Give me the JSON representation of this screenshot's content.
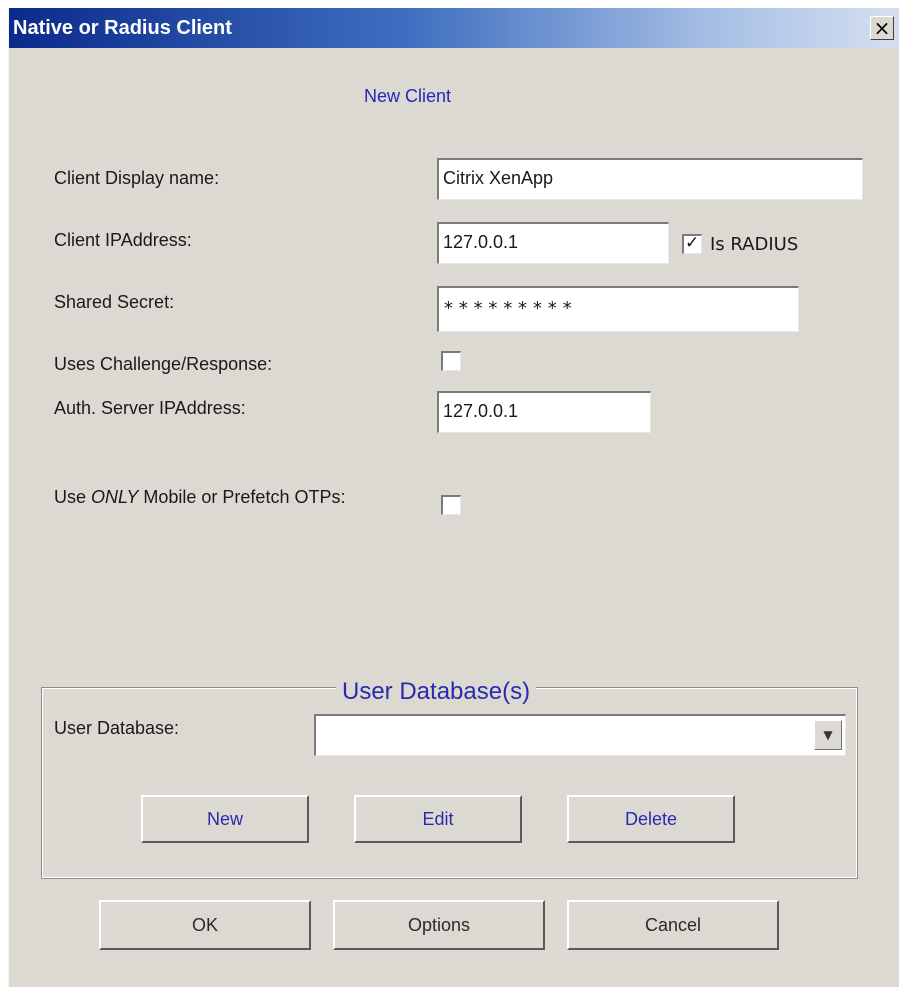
{
  "window": {
    "title": "Native or Radius Client",
    "close_label": "×"
  },
  "heading": "New Client",
  "form": {
    "display_name_label": "Client Display name:",
    "display_name_value": "Citrix XenApp",
    "ip_label": "Client IPAddress:",
    "ip_value": "127.0.0.1",
    "is_radius_label": "Is RADIUS",
    "is_radius_checked": true,
    "secret_label": "Shared Secret:",
    "secret_value": "*********",
    "challenge_label": "Uses Challenge/Response:",
    "challenge_checked": false,
    "auth_ip_label": "Auth. Server IPAddress:",
    "auth_ip_value": "127.0.0.1",
    "only_label_prefix": "Use ",
    "only_label_emph": "ONLY",
    "only_label_suffix": " Mobile or Prefetch OTPs:",
    "only_checked": false
  },
  "user_db": {
    "group_title": "User Database(s)",
    "label": "User Database:",
    "selected": "",
    "new_label": "New",
    "edit_label": "Edit",
    "delete_label": "Delete"
  },
  "footer": {
    "ok_label": "OK",
    "options_label": "Options",
    "cancel_label": "Cancel"
  },
  "colors": {
    "title_bar_start": "#0b2a8c",
    "accent_text": "#2727b5",
    "window_bg": "#dcd9d2"
  }
}
